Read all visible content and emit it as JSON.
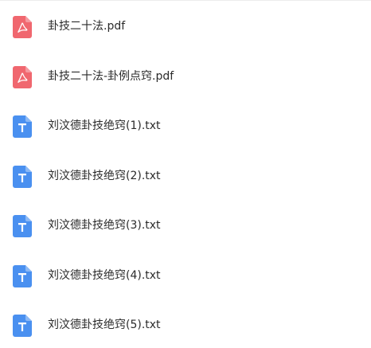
{
  "colors": {
    "pdf_icon": "#f0676f",
    "txt_icon": "#4a90f0",
    "text": "#2b2b2b"
  },
  "files": [
    {
      "name": "卦技二十法.pdf",
      "type": "pdf",
      "icon": "pdf-file-icon"
    },
    {
      "name": "卦技二十法-卦例点窍.pdf",
      "type": "pdf",
      "icon": "pdf-file-icon"
    },
    {
      "name": "刘汶德卦技绝窍(1).txt",
      "type": "txt",
      "icon": "text-file-icon"
    },
    {
      "name": "刘汶德卦技绝窍(2).txt",
      "type": "txt",
      "icon": "text-file-icon"
    },
    {
      "name": "刘汶德卦技绝窍(3).txt",
      "type": "txt",
      "icon": "text-file-icon"
    },
    {
      "name": "刘汶德卦技绝窍(4).txt",
      "type": "txt",
      "icon": "text-file-icon"
    },
    {
      "name": "刘汶德卦技绝窍(5).txt",
      "type": "txt",
      "icon": "text-file-icon"
    }
  ]
}
